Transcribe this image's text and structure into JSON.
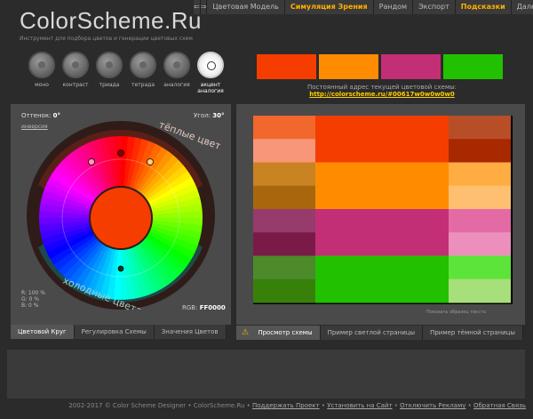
{
  "logo": "ColorScheme.Ru",
  "tagline": "Инструмент для подбора цветов и генерации цветовых схем",
  "topnav": [
    "Цветовая Модель",
    "Симуляция Зрения",
    "Рандом",
    "Экспорт",
    "Подсказки",
    "Далее ..."
  ],
  "modes": [
    "моно",
    "контраст",
    "триада",
    "тетрада",
    "аналогия",
    "акцент аналогия"
  ],
  "swatch_colors": [
    "#f63d00",
    "#ff8c00",
    "#c32f76",
    "#22c100"
  ],
  "url_label": "Постоянный адрес текущей цветовой схемы:",
  "url": "http://colorscheme.ru/#00617w0w0w0w0",
  "hue_label": "Оттенок:",
  "hue_value": "0°",
  "inversion": "инверсия",
  "angle_label": "Угол:",
  "angle_value": "30°",
  "warm": "тёплые цвета",
  "cold": "холодные цвета",
  "rgb_lines": [
    "R: 100 %",
    "G:     0 %",
    "B:     0 %"
  ],
  "rgb_label": "RGB:",
  "rgb_value": "FF0000",
  "left_tabs": [
    "Цветовой Круг",
    "Регулировка Схемы",
    "Значения Цветов"
  ],
  "right_tabs": [
    "Просмотр схемы",
    "Пример светлой страницы",
    "Пример тёмной страницы"
  ],
  "preview_text": "Показать образец текста",
  "footer": {
    "copyright": "2002-2017 © Color Scheme Designer • ColorScheme.Ru •",
    "links": [
      "Поддержать Проект",
      "Установить на Сайт",
      "Отключить Рекламу",
      "Обратная Связь"
    ]
  },
  "grid_colors": [
    [
      "#f2672c",
      "#f63d00",
      "#b84e28"
    ],
    [
      "#f8967a",
      "#f63d00",
      "#a82800"
    ],
    [
      "#c98322",
      "#ff8c00",
      "#ffac42"
    ],
    [
      "#a8670c",
      "#ff8c00",
      "#ffbf70"
    ],
    [
      "#973a6c",
      "#c32f76",
      "#e46aa6"
    ],
    [
      "#7a1a48",
      "#c32f76",
      "#ec8fbd"
    ],
    [
      "#4c8a2a",
      "#22c100",
      "#5de43a"
    ],
    [
      "#37810a",
      "#22c100",
      "#a7e07a"
    ]
  ]
}
